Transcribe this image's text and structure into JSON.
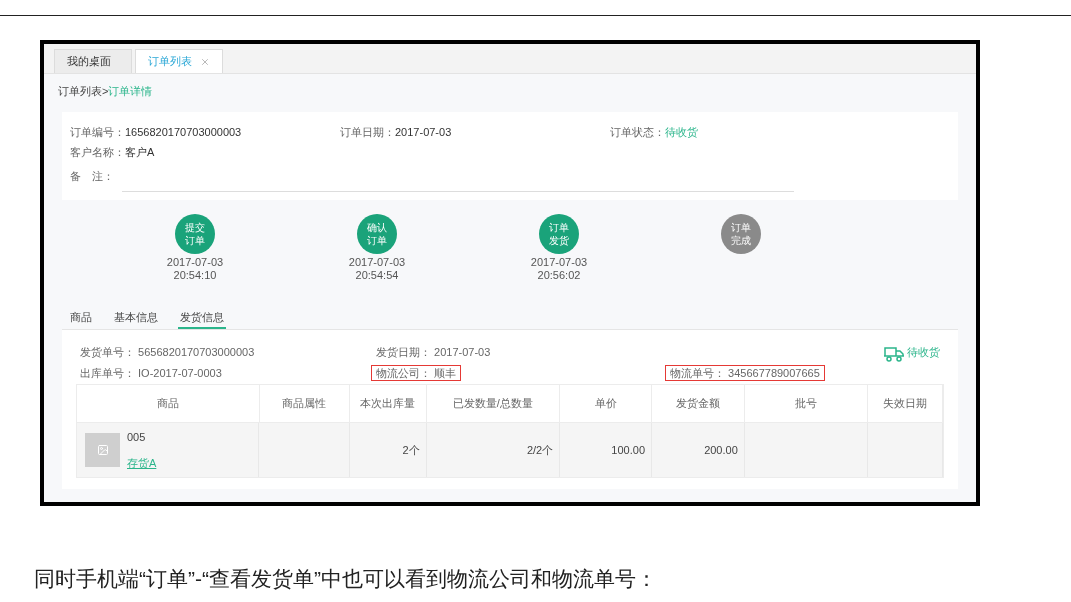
{
  "tabs": [
    {
      "label": "我的桌面",
      "selected": false,
      "closable": false
    },
    {
      "label": "订单列表",
      "selected": true,
      "closable": true
    }
  ],
  "breadcrumb": {
    "separator": ">",
    "items": [
      {
        "label": "订单列表",
        "current": false
      },
      {
        "label": "订单详情",
        "current": true
      }
    ]
  },
  "order": {
    "rows": [
      [
        {
          "label": "订单编号：",
          "value": "1656820170703000003",
          "accent": false
        },
        {
          "label": "订单日期：",
          "value": "2017-07-03",
          "accent": false
        },
        {
          "label": "订单状态：",
          "value": "待收货",
          "accent": true
        }
      ],
      [
        {
          "label": "客户名称：",
          "value": "客户A",
          "accent": false
        }
      ]
    ],
    "remark_label": "备　注："
  },
  "steps": [
    {
      "lines": [
        "提交",
        "订单"
      ],
      "date": "2017-07-03",
      "time": "20:54:10",
      "done": true
    },
    {
      "lines": [
        "确认",
        "订单"
      ],
      "date": "2017-07-03",
      "time": "20:54:54",
      "done": true
    },
    {
      "lines": [
        "订单",
        "发货"
      ],
      "date": "2017-07-03",
      "time": "20:56:02",
      "done": true
    },
    {
      "lines": [
        "订单",
        "完成"
      ],
      "done": false
    }
  ],
  "detail_tabs": [
    {
      "label": "商品",
      "selected": false
    },
    {
      "label": "基本信息",
      "selected": false
    },
    {
      "label": "发货信息",
      "selected": true
    }
  ],
  "shipment": {
    "rows": [
      [
        {
          "kind": "field",
          "label": "发货单号：",
          "value": "5656820170703000003",
          "highlighted": false
        },
        {
          "kind": "field",
          "label": "发货日期：",
          "value": "2017-07-03",
          "highlighted": false
        },
        {
          "kind": "status",
          "value": "待收货"
        }
      ],
      [
        {
          "kind": "field",
          "label": "出库单号：",
          "value": "IO-2017-07-0003",
          "highlighted": false
        },
        {
          "kind": "field",
          "label": "物流公司：",
          "value": "顺丰",
          "highlighted": true
        },
        {
          "kind": "field",
          "label": "物流单号：",
          "value": "345667789007665",
          "highlighted": true
        }
      ]
    ]
  },
  "table": {
    "columns": [
      "商品",
      "商品属性",
      "本次出库量",
      "已发数量/总数量",
      "单价",
      "发货金额",
      "批号",
      "失效日期"
    ],
    "rows": [
      {
        "cells": [
          {
            "kind": "item",
            "code": "005",
            "link": "存货A"
          },
          {
            "kind": "text",
            "text": ""
          },
          {
            "kind": "text",
            "text": "2个"
          },
          {
            "kind": "text",
            "text": "2/2个"
          },
          {
            "kind": "text",
            "text": "100.00"
          },
          {
            "kind": "text",
            "text": "200.00"
          },
          {
            "kind": "text",
            "text": ""
          },
          {
            "kind": "text",
            "text": ""
          }
        ]
      }
    ]
  },
  "caption": "同时手机端“订单”-“查看发货单”中也可以看到物流公司和物流单号："
}
